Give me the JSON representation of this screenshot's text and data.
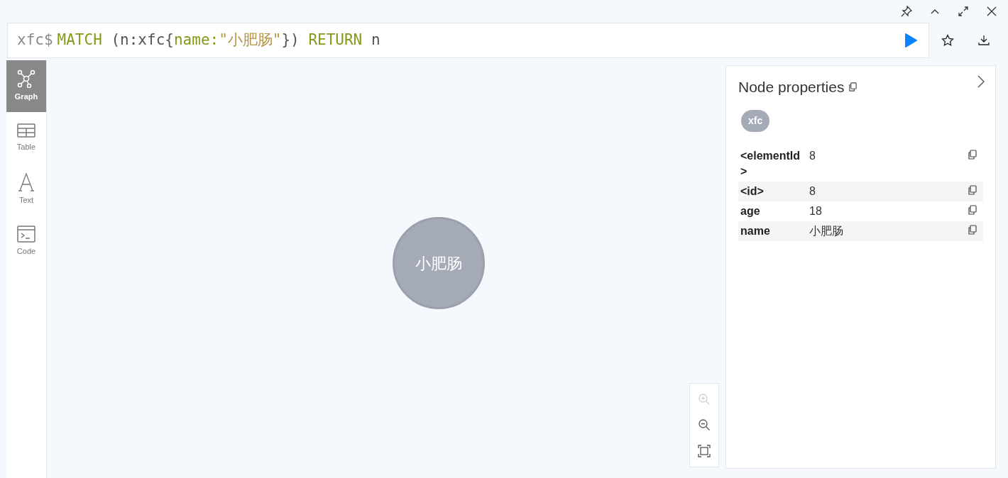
{
  "editor": {
    "prompt": "xfc$",
    "tokens": [
      {
        "text": "MATCH",
        "kind": "keyword"
      },
      {
        "text": " (n:xfc{",
        "kind": "plain"
      },
      {
        "text": "name:",
        "kind": "keyword"
      },
      {
        "text": "\"小肥肠\"",
        "kind": "string"
      },
      {
        "text": "}) ",
        "kind": "plain"
      },
      {
        "text": "RETURN",
        "kind": "keyword"
      },
      {
        "text": " n",
        "kind": "plain"
      }
    ]
  },
  "sidebar": {
    "items": [
      {
        "label": "Graph",
        "kind": "graph",
        "selected": true
      },
      {
        "label": "Table",
        "kind": "table",
        "selected": false
      },
      {
        "label": "Text",
        "kind": "text",
        "selected": false
      },
      {
        "label": "Code",
        "kind": "code",
        "selected": false
      }
    ]
  },
  "graph": {
    "nodes": [
      {
        "caption": "小肥肠"
      }
    ]
  },
  "zoom_controls": [
    {
      "kind": "zoom-in",
      "disabled": true
    },
    {
      "kind": "zoom-out",
      "disabled": false
    },
    {
      "kind": "fit",
      "disabled": false
    }
  ],
  "properties_panel": {
    "title": "Node properties",
    "labels": [
      "xfc"
    ],
    "rows": [
      {
        "key": "<elementId>",
        "value": "8"
      },
      {
        "key": "<id>",
        "value": "8"
      },
      {
        "key": "age",
        "value": "18"
      },
      {
        "key": "name",
        "value": "小肥肠"
      }
    ]
  }
}
